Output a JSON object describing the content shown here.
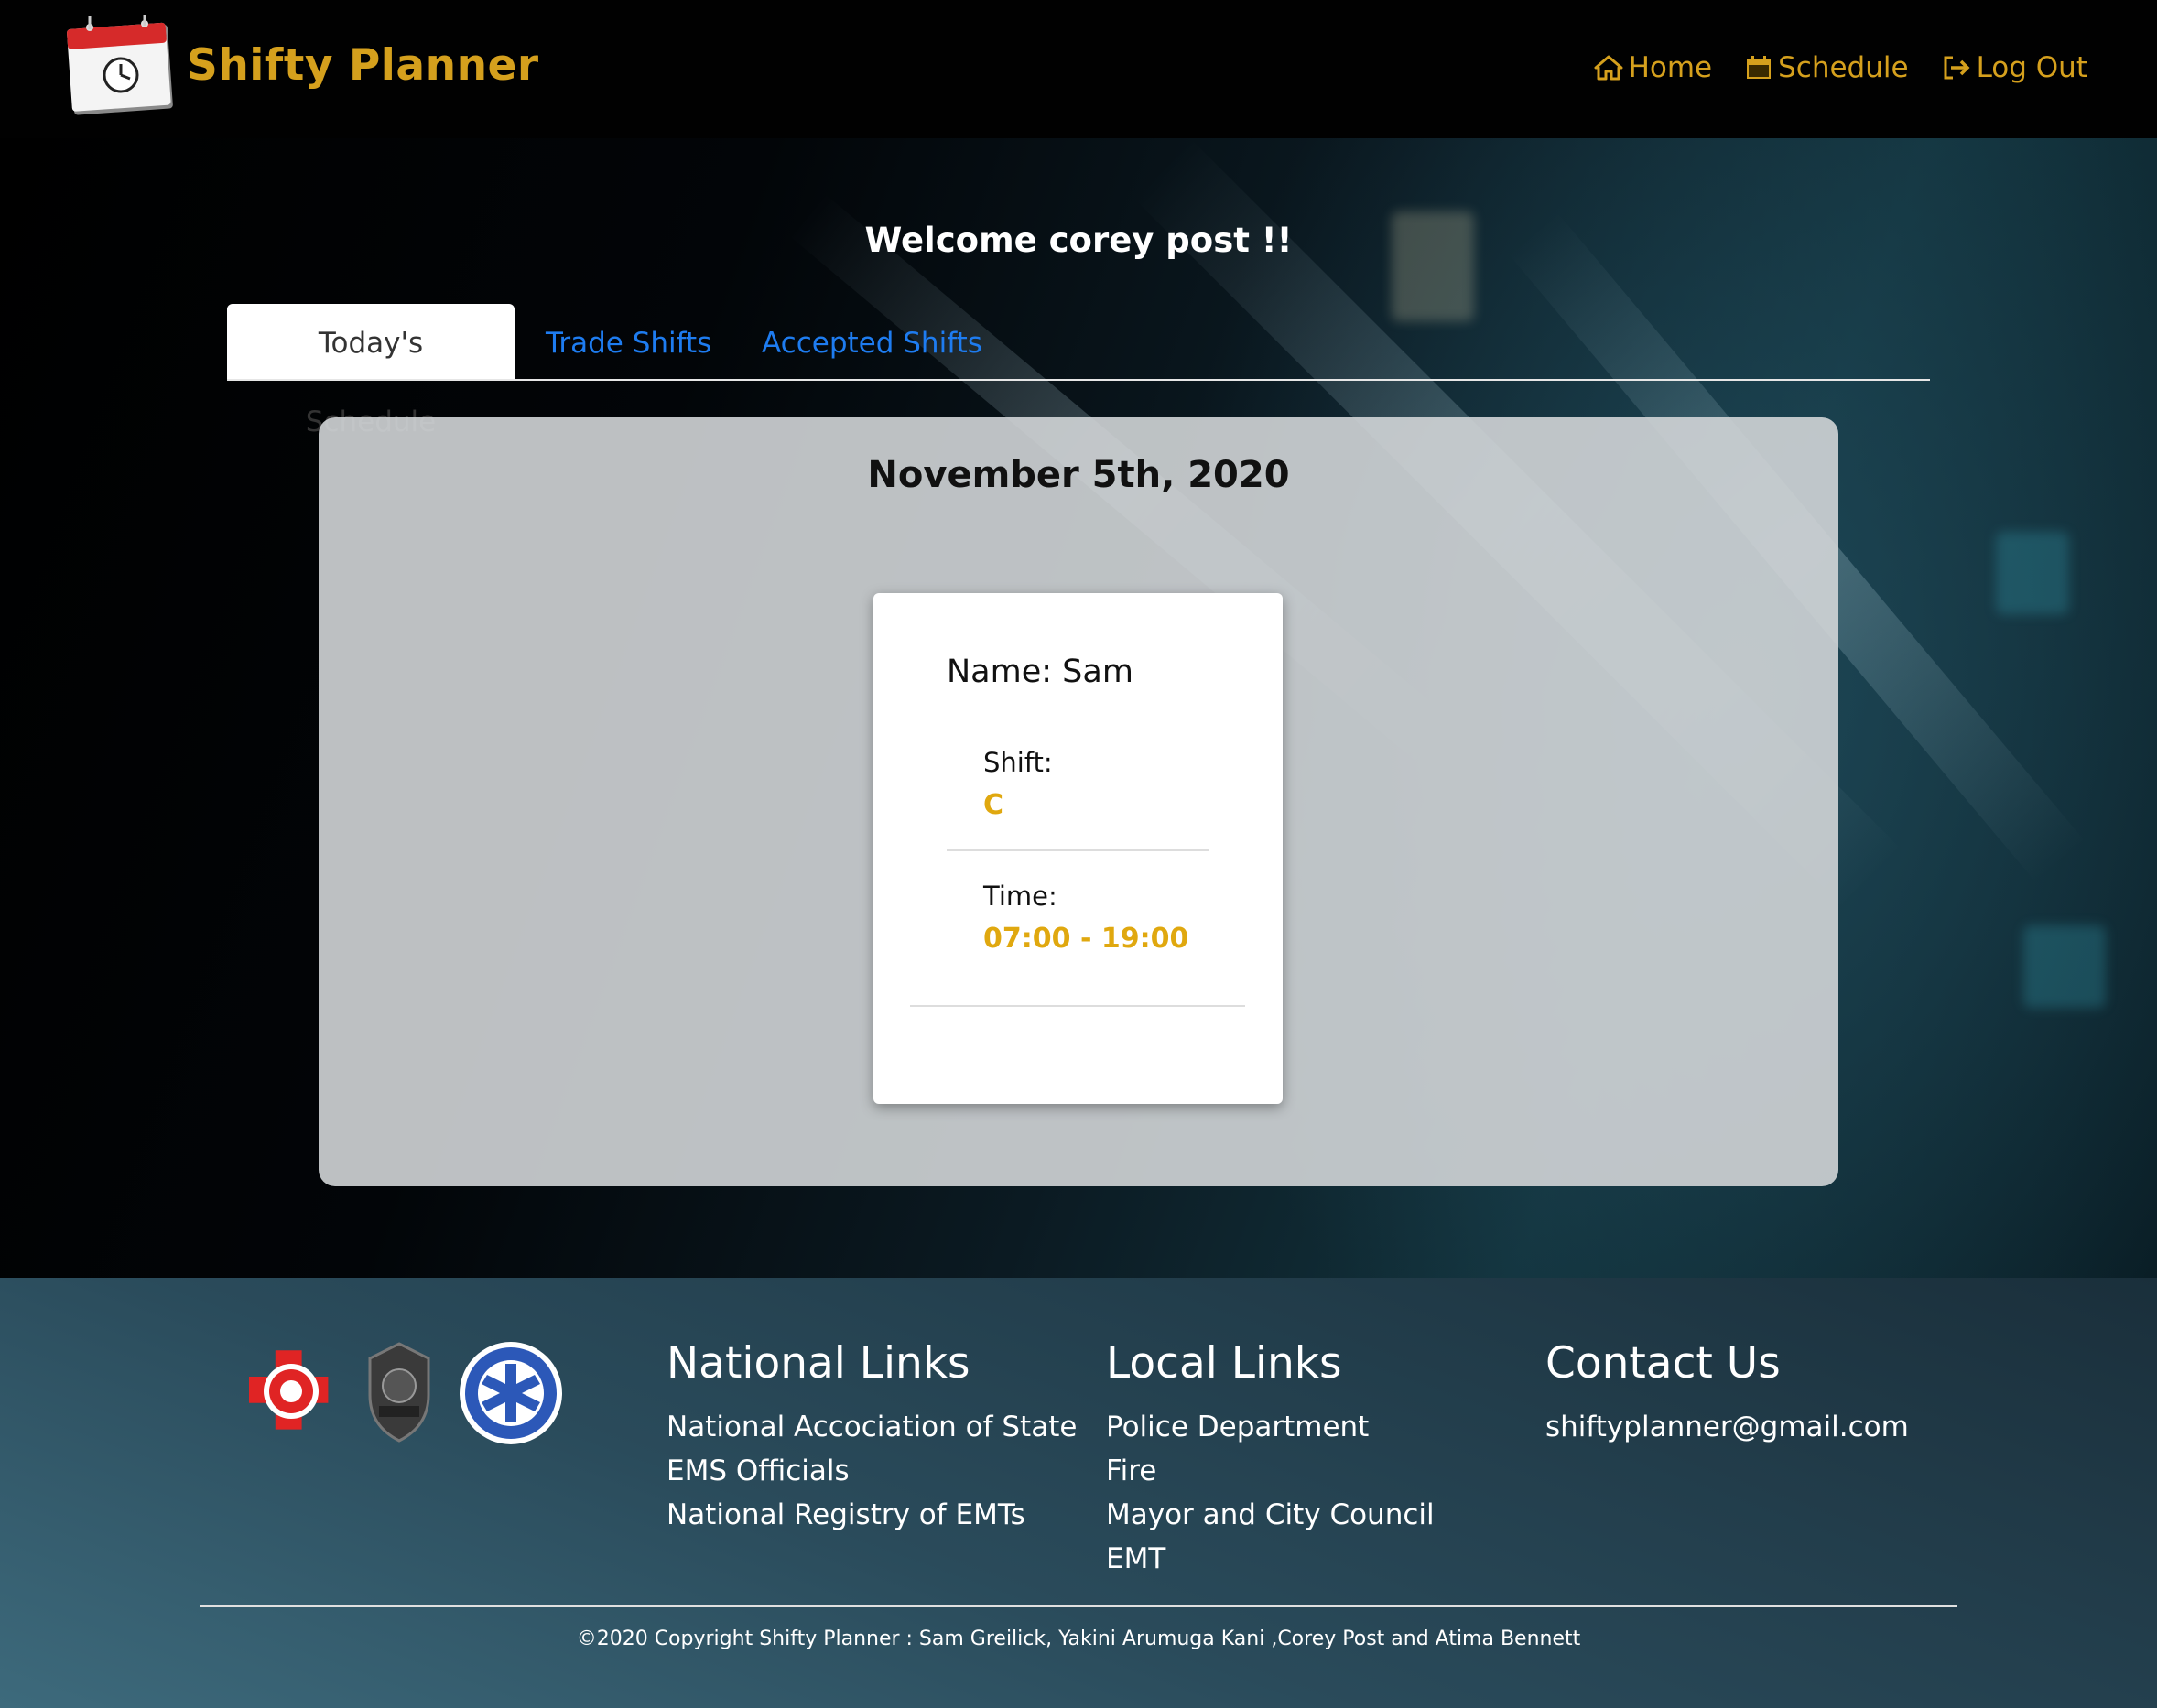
{
  "header": {
    "brand": "Shifty Planner",
    "nav": [
      {
        "label": "Home",
        "icon": "home-icon"
      },
      {
        "label": "Schedule",
        "icon": "calendar-icon"
      },
      {
        "label": "Log Out",
        "icon": "logout-icon"
      }
    ]
  },
  "welcome": "Welcome corey post !!",
  "tabs": [
    {
      "label": "Today's Schedule",
      "active": true
    },
    {
      "label": "Trade Shifts",
      "active": false
    },
    {
      "label": "Accepted Shifts",
      "active": false
    }
  ],
  "schedule": {
    "date": "November 5th, 2020",
    "card": {
      "name": "Name: Sam",
      "shift_label": "Shift:",
      "shift_value": "C",
      "time_label": "Time:",
      "time_value": "07:00 - 19:00"
    }
  },
  "footer": {
    "national": {
      "title": "National Links",
      "links": [
        "National Accociation of State",
        "EMS Officials",
        "National Registry of EMTs"
      ]
    },
    "local": {
      "title": "Local Links",
      "links": [
        "Police Department",
        "Fire",
        "Mayor and City Council",
        "EMT"
      ]
    },
    "contact": {
      "title": "Contact Us",
      "email": "shiftyplanner@gmail.com"
    },
    "copyright": "©2020 Copyright Shifty Planner : Sam Greilick, Yakini Arumuga Kani ,Corey Post and Atima Bennett",
    "badges": [
      "fire-dept-badge",
      "police-badge",
      "ems-badge"
    ]
  },
  "colors": {
    "accent": "#d5a01d",
    "tab_link": "#1e7cf0",
    "value_gold": "#e0a80f"
  }
}
